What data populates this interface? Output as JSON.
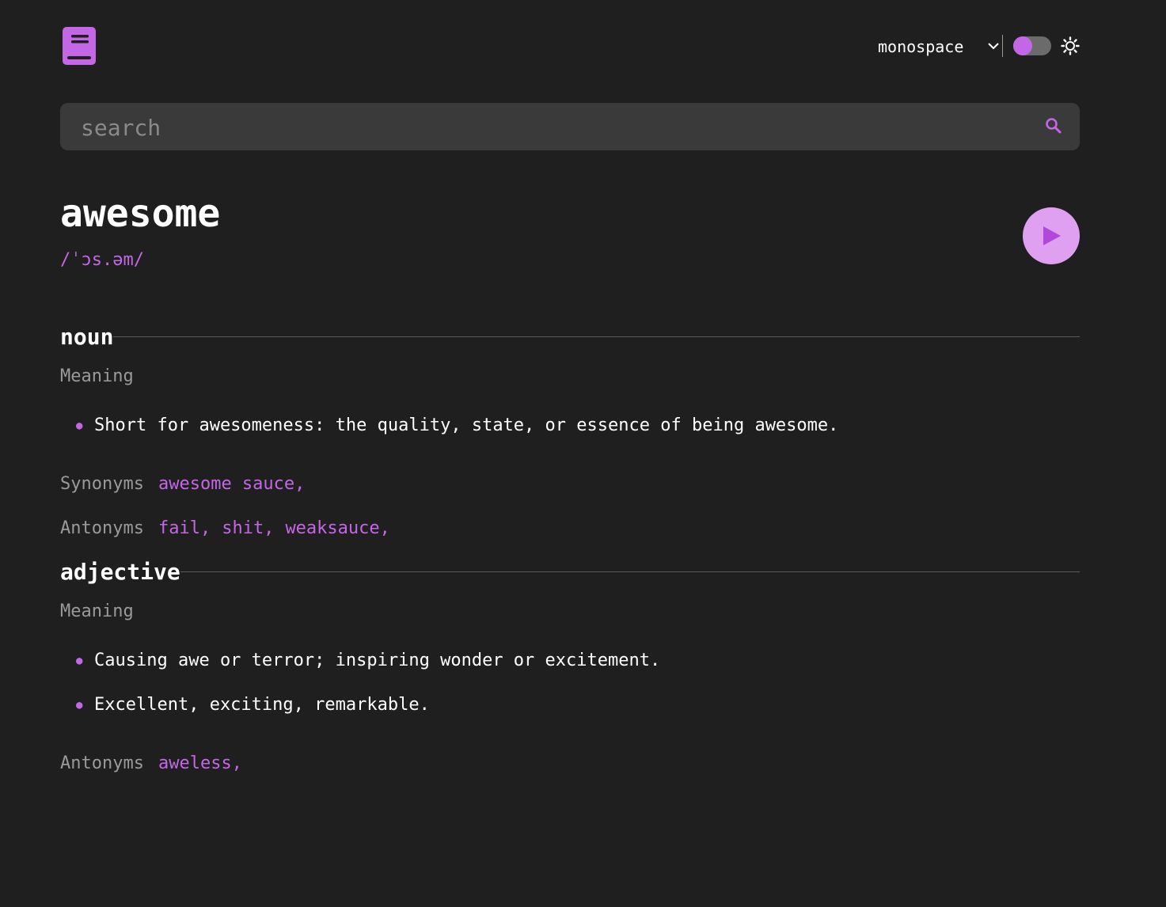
{
  "header": {
    "logo_icon": "book-icon",
    "font_select": {
      "value": "monospace",
      "icon": "chevron-down-icon"
    },
    "theme_toggle": {
      "state": "on",
      "accent": "#c467e6"
    },
    "theme_icon": "sun-icon"
  },
  "search": {
    "placeholder": "search",
    "value": "",
    "icon": "search-icon"
  },
  "entry": {
    "word": "awesome",
    "phonetic": "/ˈɔs.əm/",
    "play_icon": "play-icon",
    "noun": {
      "label": "noun",
      "meaning_label": "Meaning",
      "definitions": [
        "Short for awesomeness: the quality, state, or essence of being awesome."
      ],
      "synonyms_label": "Synonyms",
      "synonyms": [
        "awesome sauce,"
      ],
      "antonyms_label": "Antonyms",
      "antonyms": [
        "fail,",
        "shit,",
        "weaksauce,"
      ]
    },
    "adjective": {
      "label": "adjective",
      "meaning_label": "Meaning",
      "definitions": [
        "Causing awe or terror; inspiring wonder or excitement.",
        "Excellent, exciting, remarkable."
      ],
      "antonyms_label": "Antonyms",
      "antonyms": [
        "aweless,"
      ]
    }
  },
  "colors": {
    "background": "#1f1f1f",
    "accent": "#c467e6",
    "muted_text": "#9a9a9a",
    "search_bg": "#3a3a3a"
  }
}
